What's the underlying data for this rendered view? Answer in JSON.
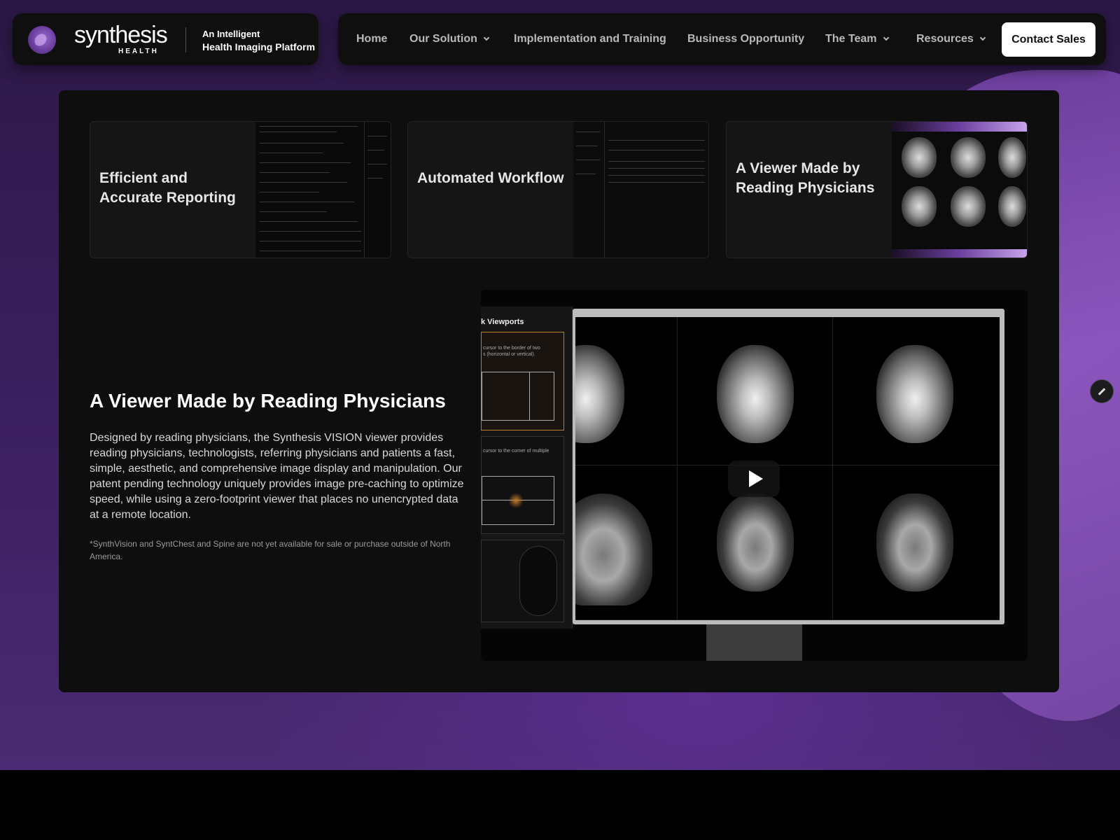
{
  "brand": {
    "name": "synthesis",
    "sub": "HEALTH",
    "tagline_line1": "An Intelligent",
    "tagline_line2": "Health Imaging Platform"
  },
  "nav": {
    "items": [
      {
        "label": "Home",
        "dropdown": false
      },
      {
        "label": "Our Solution",
        "dropdown": true
      },
      {
        "label": "Implementation and Training",
        "dropdown": false
      },
      {
        "label": "Business Opportunity",
        "dropdown": false
      },
      {
        "label": "The Team",
        "dropdown": true
      },
      {
        "label": "Resources",
        "dropdown": true
      }
    ],
    "cta": "Contact Sales"
  },
  "cards": [
    {
      "title": "Efficient and Accurate Reporting"
    },
    {
      "title": "Automated Workflow"
    },
    {
      "title": "A Viewer Made by Reading Physicians"
    }
  ],
  "section": {
    "title": "A Viewer Made by Reading Physicians",
    "body": "Designed by reading physicians, the Synthesis VISION viewer provides reading physicians, technologists, referring physicians and patients a fast, simple, aesthetic, and comprehensive image display and manipulation.  Our patent pending technology uniquely provides image pre-caching to optimize speed, while using a zero-footprint viewer that places no unencrypted data at a remote location.",
    "footnote": "*SynthVision and SyntChest and Spine are not yet available for sale or purchase outside of North America."
  },
  "video": {
    "sidebar_title": "k Viewports",
    "hint1_line1": "cursor to the border of two",
    "hint1_line2": "s (horizontal or vertical).",
    "hint2": "cursor to the corner of multiple"
  },
  "colors": {
    "accent": "#7c47b0",
    "panel": "#0e0e0e",
    "highlight": "#c07a2a"
  },
  "icons": {
    "play": "play-icon",
    "edit": "edit-icon",
    "chevron": "chevron-down-icon"
  }
}
